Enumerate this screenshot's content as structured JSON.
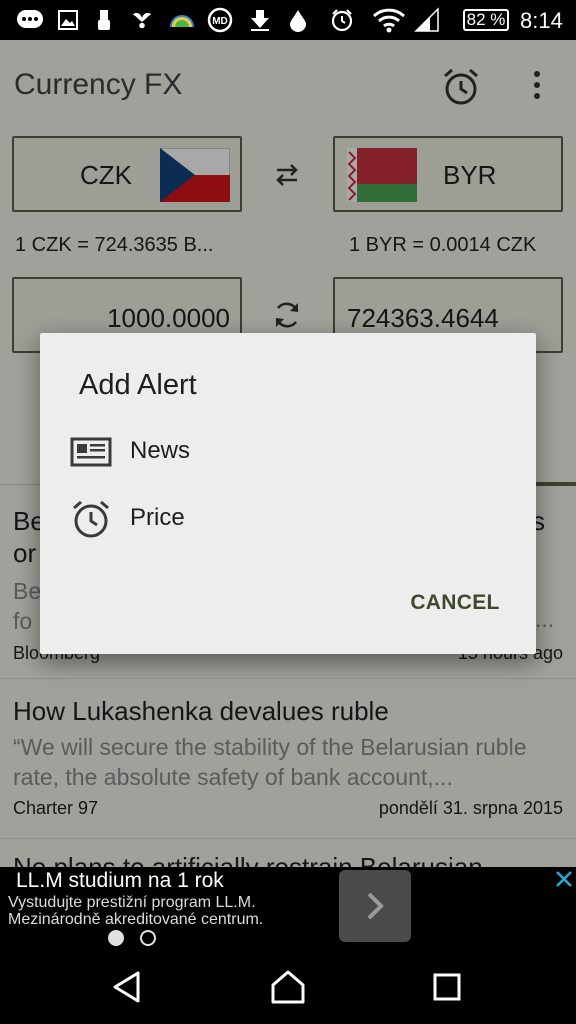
{
  "status_bar": {
    "icons": [
      "message-icon",
      "image-icon",
      "usb-icon",
      "bird-icon",
      "weather-icon",
      "md-icon",
      "download-icon",
      "drop-icon",
      "alarm-icon",
      "wifi-icon",
      "signal-icon"
    ],
    "battery": "82 %",
    "time": "8:14"
  },
  "app": {
    "title": "Currency FX",
    "toolbar_icons": [
      "alarm-icon",
      "more-vert-icon"
    ],
    "from_currency": {
      "code": "CZK",
      "flag": "Czech Republic"
    },
    "to_currency": {
      "code": "BYR",
      "flag": "Belarus"
    },
    "from_rate": "1 CZK = 724.3635 B...",
    "to_rate": "1 BYR = 0.0014 CZK",
    "from_amount": "1000.0000",
    "to_amount": "724363.4644",
    "news": [
      {
        "title": "Be",
        "title_right": "s",
        "title2": "or",
        "desc": "Be",
        "desc2": "fo",
        "desc2_right": "...",
        "source": "Bloomberg",
        "date": "15 hours ago"
      },
      {
        "title": "How Lukashenka devalues ruble",
        "desc": "“We will secure the stability of the Belarusian ruble rate, the absolute safety of bank account,...",
        "source": "Charter 97",
        "date": "pondělí 31. srpna 2015"
      },
      {
        "title": "No plans to artificially restrain Belarusian"
      }
    ]
  },
  "dialog": {
    "title": "Add Alert",
    "items": [
      {
        "label": "News",
        "icon": "newspaper-icon"
      },
      {
        "label": "Price",
        "icon": "alarm-icon"
      }
    ],
    "cancel": "CANCEL"
  },
  "ad": {
    "title": "LL.M studium na 1 rok",
    "line1": "Vystudujte prestižní program LL.M.",
    "line2": "Mezinárodně akreditované centrum.",
    "pages": 2,
    "active_page": 1
  },
  "colors": {
    "app_bg": "#f3f4ec",
    "box_border": "#5a5f4b",
    "dialog_bg": "#ededed",
    "accent": "#3f4a2c"
  }
}
